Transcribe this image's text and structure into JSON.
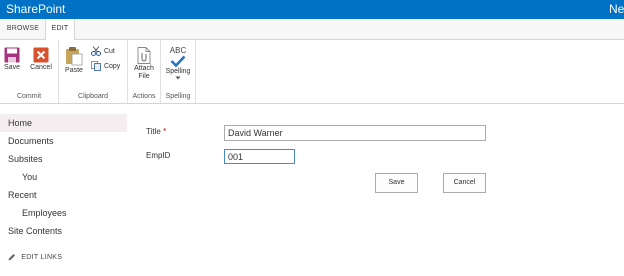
{
  "suite_bar": {
    "title": "SharePoint",
    "right_text": "Ne"
  },
  "ribbon": {
    "tabs": [
      {
        "label": "BROWSE"
      },
      {
        "label": "EDIT"
      }
    ],
    "groups": {
      "commit": {
        "label": "Commit",
        "save": "Save",
        "cancel": "Cancel"
      },
      "clipboard": {
        "label": "Clipboard",
        "paste": "Paste",
        "cut": "Cut",
        "copy": "Copy"
      },
      "actions": {
        "label": "Actions",
        "attach_line1": "Attach",
        "attach_line2": "File"
      },
      "spelling": {
        "label": "Spelling",
        "abc": "ABC",
        "spelling": "Spelling"
      }
    }
  },
  "nav": {
    "items": [
      {
        "label": "Home"
      },
      {
        "label": "Documents"
      },
      {
        "label": "Subsites"
      },
      {
        "label": "You"
      },
      {
        "label": "Recent"
      },
      {
        "label": "Employees"
      },
      {
        "label": "Site Contents"
      }
    ],
    "edit_links": "EDIT LINKS"
  },
  "form": {
    "title_label": "Title",
    "required_mark": "*",
    "title_value": "David Warner",
    "empid_label": "EmpID",
    "empid_value": "001",
    "save": "Save",
    "cancel": "Cancel"
  },
  "colors": {
    "suite_bar": "#0072c6",
    "save_icon": "#a7337e",
    "cancel_icon": "#d9502d",
    "spell_check": "#2a73c0"
  }
}
